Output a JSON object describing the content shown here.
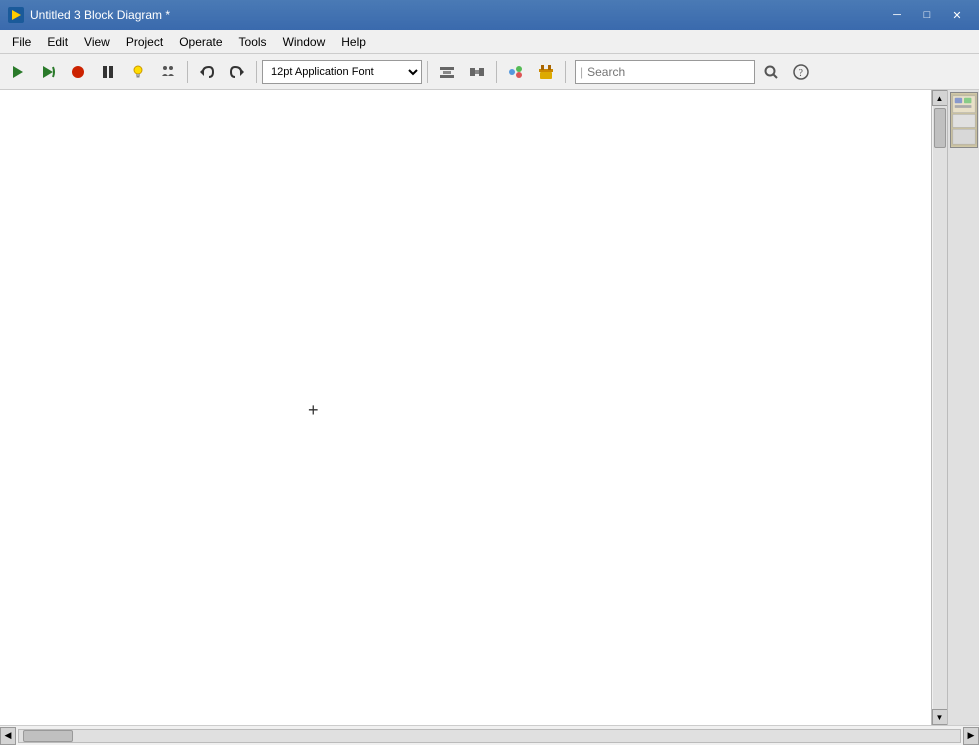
{
  "titlebar": {
    "title": "Untitled 3 Block Diagram *",
    "app_icon": "▶",
    "minimize_label": "─",
    "maximize_label": "□",
    "close_label": "✕"
  },
  "menubar": {
    "items": [
      {
        "label": "File"
      },
      {
        "label": "Edit"
      },
      {
        "label": "View"
      },
      {
        "label": "Project"
      },
      {
        "label": "Operate"
      },
      {
        "label": "Tools"
      },
      {
        "label": "Window"
      },
      {
        "label": "Help"
      }
    ]
  },
  "toolbar": {
    "font_value": "12pt Application Font",
    "search_placeholder": "Search",
    "buttons": [
      {
        "name": "run-arrow",
        "icon": "▷",
        "tooltip": "Run"
      },
      {
        "name": "run-continuous",
        "icon": "↺",
        "tooltip": "Run Continuously"
      },
      {
        "name": "abort",
        "icon": "⬤",
        "tooltip": "Abort"
      },
      {
        "name": "pause",
        "icon": "⏸",
        "tooltip": "Pause"
      },
      {
        "name": "highlight",
        "icon": "💡",
        "tooltip": "Highlight Execution"
      },
      {
        "name": "step-over",
        "icon": "⚙",
        "tooltip": "Step Over"
      },
      {
        "name": "undo",
        "icon": "↩",
        "tooltip": "Undo"
      },
      {
        "name": "redo",
        "icon": "↪",
        "tooltip": "Redo"
      },
      {
        "name": "align",
        "icon": "⊟",
        "tooltip": "Align"
      },
      {
        "name": "distribute",
        "icon": "⊠",
        "tooltip": "Distribute"
      },
      {
        "name": "resize",
        "icon": "⊡",
        "tooltip": "Resize"
      },
      {
        "name": "reorder",
        "icon": "🔧",
        "tooltip": "Reorder"
      }
    ]
  },
  "canvas": {
    "cursor_symbol": "+"
  },
  "right_panel": {
    "thumbnail": "◫"
  },
  "colors": {
    "titlebar_bg": "#3a6aad",
    "canvas_bg": "#ffffff",
    "toolbar_bg": "#f0f0f0"
  }
}
